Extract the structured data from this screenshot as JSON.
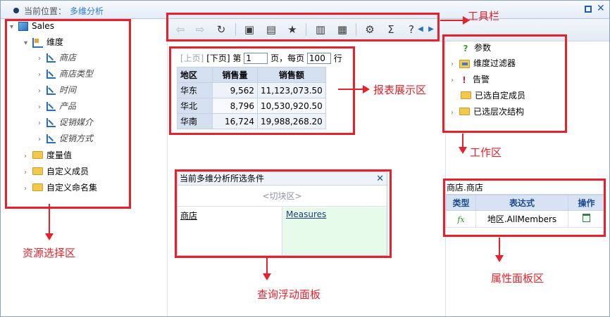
{
  "header": {
    "location_label": "当前位置：",
    "current_page": "多维分析"
  },
  "resource_tree": {
    "root": "Sales",
    "dimensions_folder": "维度",
    "dimension_items": [
      "商店",
      "商店类型",
      "时间",
      "产品",
      "促销媒介",
      "促销方式"
    ],
    "other_folders": [
      "度量值",
      "自定义成员",
      "自定义命名集"
    ]
  },
  "toolbar": {
    "icons": [
      "back-icon",
      "forward-icon",
      "refresh-icon",
      "save-icon",
      "save-as-icon",
      "favorite-icon",
      "chart-icon",
      "layout-icon",
      "settings-icon",
      "sum-icon",
      "help-icon",
      "scroll-left-icon",
      "scroll-right-icon"
    ]
  },
  "pager": {
    "prev": "[上页]",
    "next": "[下页]",
    "page_prefix": "第",
    "page_value": "1",
    "page_suffix": "页，每页",
    "page_size": "100",
    "rows_suffix": "行"
  },
  "report": {
    "headers": [
      "地区",
      "销售量",
      "销售额"
    ],
    "rows": [
      [
        "华东",
        "9,562",
        "11,123,073.50"
      ],
      [
        "华北",
        "8,796",
        "10,530,920.50"
      ],
      [
        "华南",
        "16,724",
        "19,988,268.20"
      ]
    ]
  },
  "query_panel": {
    "title": "当前多维分析所选条件",
    "close": "✕",
    "slice": "<切块区>",
    "rows": "商店",
    "columns": "Measures"
  },
  "workspace": {
    "items": [
      "参数",
      "维度过滤器",
      "告警",
      "已选自定成员",
      "已选层次结构"
    ]
  },
  "properties": {
    "title": "商店.商店",
    "headers": [
      "类型",
      "表达式",
      "操作"
    ],
    "row": {
      "type": "fx",
      "expression": "地区.AllMembers"
    }
  },
  "annotations": {
    "toolbar": "工具栏",
    "report_area": "报表展示区",
    "workspace": "工作区",
    "resource_area": "资源选择区",
    "query_panel": "查询浮动面板",
    "property_panel": "属性面板区"
  },
  "colors": {
    "annotation": "#e8202a",
    "accent": "#2f7bd8",
    "header_bg": "#d4e0f0"
  }
}
